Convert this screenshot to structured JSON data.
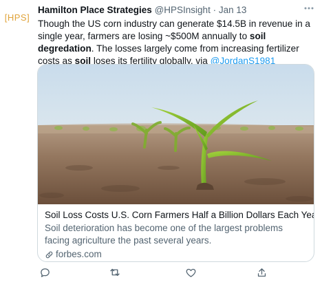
{
  "account": {
    "avatar_text": "[HPS]",
    "name": "Hamilton Place Strategies",
    "handle": "@HPSInsight",
    "separator": "·",
    "date": "Jan 13"
  },
  "tweet": {
    "text_part1": "Though the US corn industry can generate $14.5B in revenue in a single year, farmers are losing ~$500M annually to ",
    "bold1": "soil degredation",
    "text_part2": ". The losses largely come from increasing fertilizer costs as ",
    "bold2": "soil",
    "text_part3": " loses its fertility globally, via ",
    "mention": "@JordanS1981"
  },
  "card": {
    "image_icon": "corn-seedlings-photo",
    "title": "Soil Loss Costs U.S. Corn Farmers Half a Billion Dollars Each Year",
    "description": "Soil deterioration has become one of the largest problems facing agriculture the past several years.",
    "domain": "forbes.com"
  },
  "actions": [
    {
      "icon": "reply-icon"
    },
    {
      "icon": "retweet-icon"
    },
    {
      "icon": "like-icon"
    },
    {
      "icon": "share-icon"
    }
  ],
  "colors": {
    "link": "#1d9bf0",
    "secondary_text": "#536471",
    "avatar_brand": "#e0a33a"
  }
}
